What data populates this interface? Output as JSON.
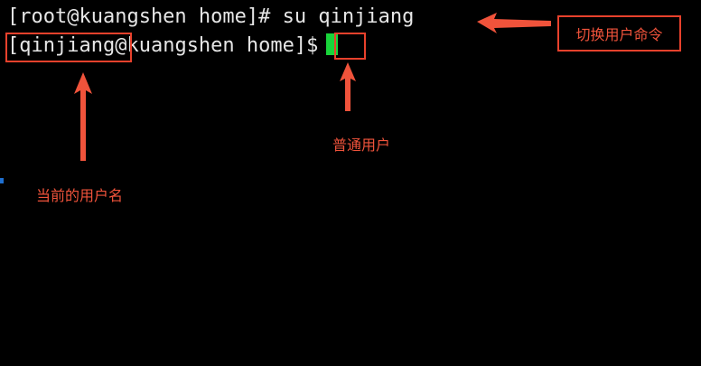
{
  "terminal": {
    "line1": "[root@kuangshen home]# su qinjiang",
    "line2_user": "[qinjiang",
    "line2_host": "@kuangshen home]",
    "line2_prompt": "$",
    "cursor_color": "#19d43a",
    "background": "#000000",
    "text_color": "#e6e6e6"
  },
  "annotations": {
    "switch_user_command": "切换用户命令",
    "normal_user": "普通用户",
    "current_username": "当前的用户名",
    "color": "#e8412c"
  }
}
